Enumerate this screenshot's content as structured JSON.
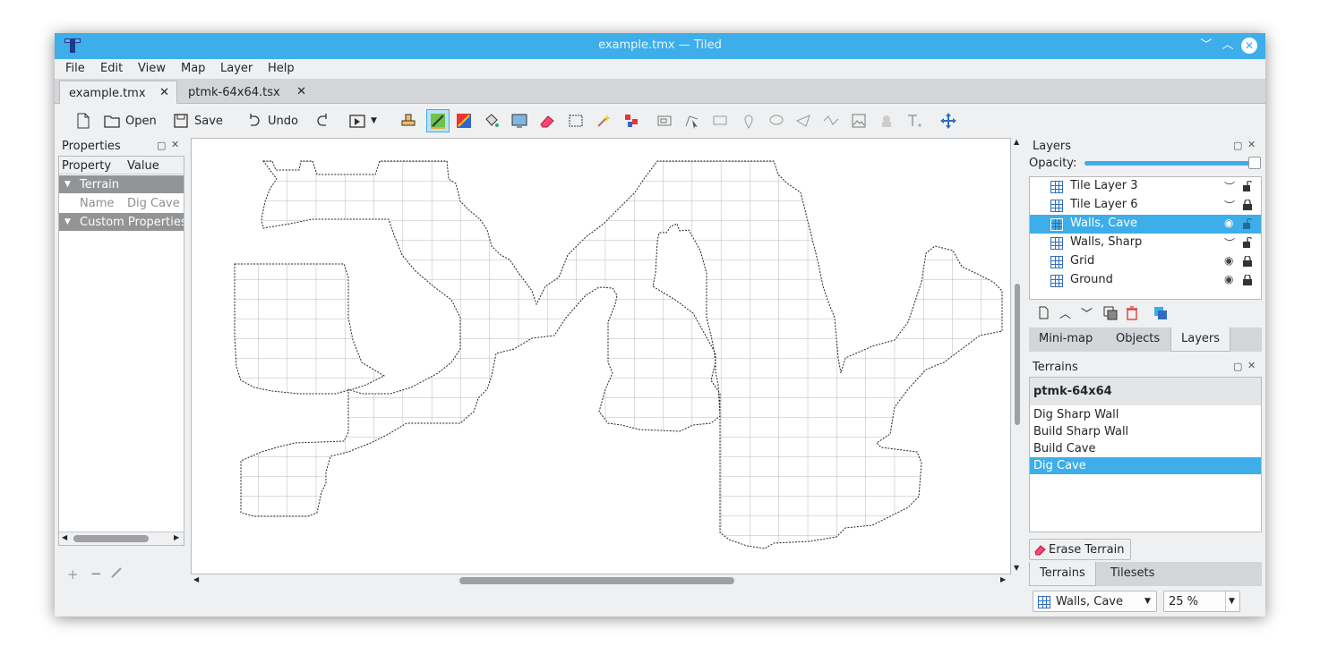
{
  "window": {
    "title": "example.tmx — Tiled"
  },
  "menu": [
    "File",
    "Edit",
    "View",
    "Map",
    "Layer",
    "Help"
  ],
  "tabs": [
    {
      "label": "example.tmx",
      "close": "✕"
    },
    {
      "label": "ptmk-64x64.tsx",
      "close": "✕"
    }
  ],
  "toolbar": {
    "open_label": "Open",
    "save_label": "Save",
    "undo_label": "Undo"
  },
  "properties": {
    "title": "Properties",
    "col_property": "Property",
    "col_value": "Value",
    "group_terrain": "Terrain",
    "name_key": "Name",
    "name_value": "Dig Cave",
    "group_custom": "Custom Properties"
  },
  "layers_panel": {
    "title": "Layers",
    "opacity_label": "Opacity:",
    "opacity": 1.0,
    "layers": [
      {
        "name": "Tile Layer 3",
        "visible": false,
        "locked": false,
        "selected": false
      },
      {
        "name": "Tile Layer 6",
        "visible": false,
        "locked": true,
        "selected": false
      },
      {
        "name": "Walls, Cave",
        "visible": true,
        "locked": false,
        "selected": true
      },
      {
        "name": "Walls, Sharp",
        "visible": false,
        "locked": false,
        "selected": false
      },
      {
        "name": "Grid",
        "visible": true,
        "locked": true,
        "selected": false
      },
      {
        "name": "Ground",
        "visible": true,
        "locked": true,
        "selected": false
      }
    ]
  },
  "mid_tabs": [
    "Mini-map",
    "Objects",
    "Layers"
  ],
  "terrains_panel": {
    "title": "Terrains",
    "tileset": "ptmk-64x64",
    "items": [
      "Dig Sharp Wall",
      "Build Sharp Wall",
      "Build Cave",
      "Dig Cave"
    ],
    "selected": "Dig Cave",
    "erase_label": "Erase Terrain"
  },
  "bottom_tabs": [
    "Terrains",
    "Tilesets"
  ],
  "status": {
    "layer_combo": "Walls, Cave",
    "zoom": "25 %"
  },
  "colors": {
    "accent": "#3daee9",
    "window_bg": "#eff0f1"
  }
}
